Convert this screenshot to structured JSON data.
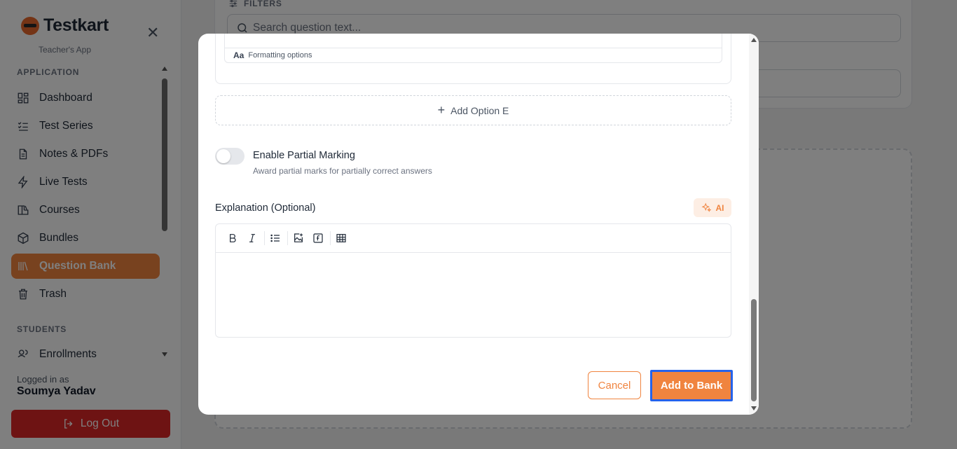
{
  "brand": {
    "name": "Testkart",
    "subtitle": "Teacher's App",
    "accent": "#e8692c"
  },
  "sidebar": {
    "sections": [
      {
        "label": "APPLICATION"
      },
      {
        "label": "STUDENTS"
      }
    ],
    "items": [
      {
        "label": "Dashboard",
        "icon": "dashboard-icon"
      },
      {
        "label": "Test Series",
        "icon": "checklist-icon"
      },
      {
        "label": "Notes & PDFs",
        "icon": "file-icon"
      },
      {
        "label": "Live Tests",
        "icon": "lightning-icon"
      },
      {
        "label": "Courses",
        "icon": "book-icon"
      },
      {
        "label": "Bundles",
        "icon": "box-icon"
      },
      {
        "label": "Question Bank",
        "icon": "library-icon",
        "active": true
      },
      {
        "label": "Trash",
        "icon": "trash-icon"
      },
      {
        "label": "Enrollments",
        "icon": "users-icon"
      }
    ],
    "footer": {
      "logged_in_label": "Logged in as",
      "user_name": "Soumya Yadav",
      "logout_label": "Log Out"
    }
  },
  "background": {
    "filters_label": "FILTERS",
    "search_placeholder": "Search question text..."
  },
  "modal": {
    "formatting_options_label": "Formatting options",
    "add_option_label": "Add Option E",
    "partial_marking": {
      "title": "Enable Partial Marking",
      "subtitle": "Award partial marks for partially correct answers",
      "enabled": false
    },
    "explanation_label": "Explanation (Optional)",
    "ai_label": "AI",
    "toolbar": [
      "bold",
      "italic",
      "bullet-list",
      "insert-image",
      "formula",
      "table"
    ],
    "cancel_label": "Cancel",
    "submit_label": "Add to Bank"
  },
  "colors": {
    "accent": "#f0843f",
    "danger": "#dc2626",
    "focus": "#2563eb"
  }
}
